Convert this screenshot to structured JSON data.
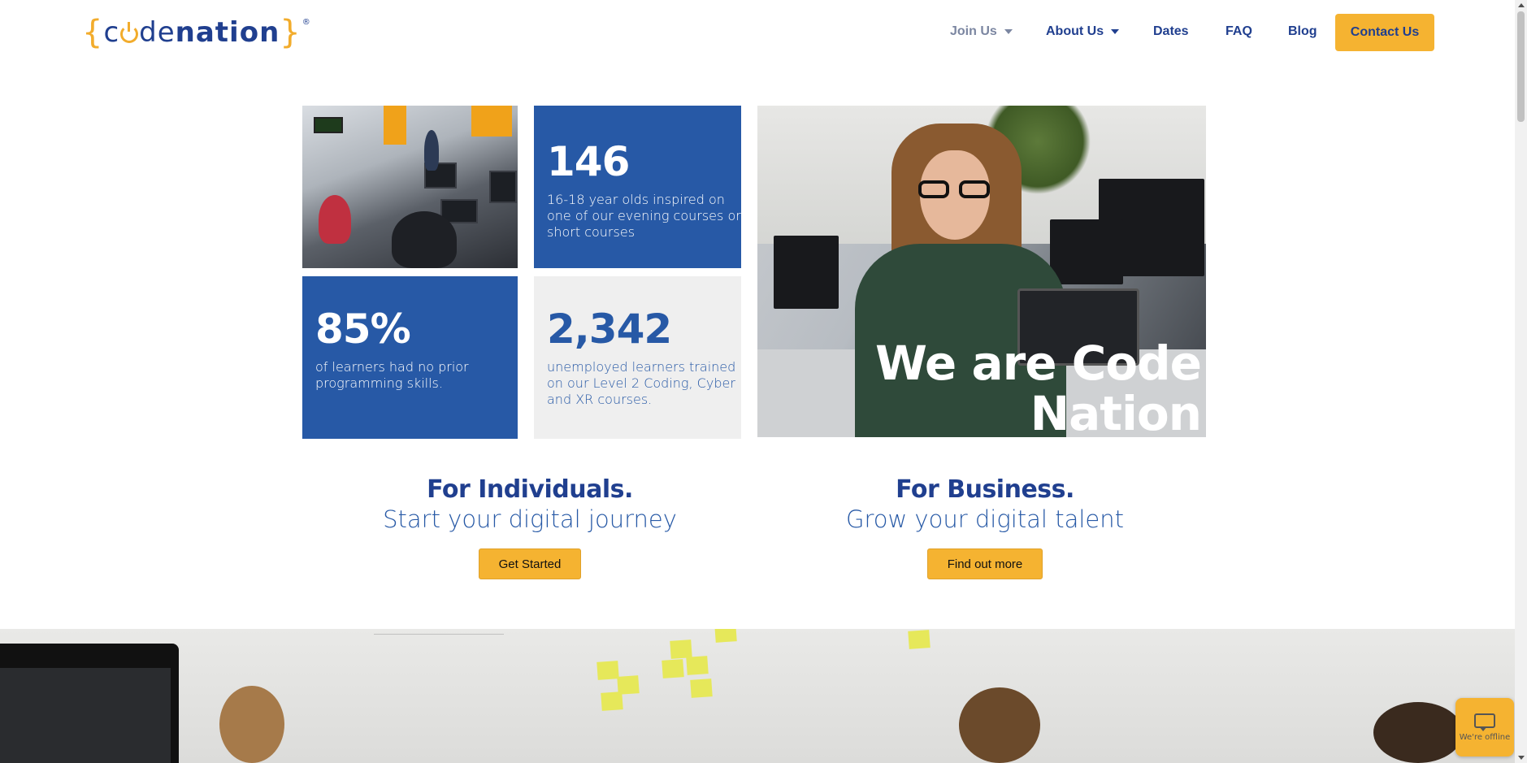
{
  "brand": {
    "logo_open": "{",
    "logo_code_c": "c",
    "logo_code_rest": "de",
    "logo_nation": "nation",
    "logo_close": "}",
    "logo_reg": "®",
    "accent_color": "#f5b331",
    "primary_color": "#203f8f",
    "stat_blue": "#2759a6"
  },
  "nav": {
    "items": [
      {
        "label": "Join Us",
        "dropdown": true,
        "active": true
      },
      {
        "label": "About Us",
        "dropdown": true
      },
      {
        "label": "Dates"
      },
      {
        "label": "FAQ"
      },
      {
        "label": "Blog"
      }
    ],
    "cta": "Contact Us"
  },
  "stats": {
    "s146": {
      "number": "146",
      "text": "16-18 year olds inspired on one of our evening courses or short courses"
    },
    "s85": {
      "number": "85%",
      "text": "of learners had no prior programming skills."
    },
    "s2342": {
      "number": "2,342",
      "text": "unemployed learners trained on our Level 2 Coding, Cyber and XR courses."
    }
  },
  "hero": {
    "overlay_line1": "We are Code",
    "overlay_line2": "Nation"
  },
  "individuals": {
    "heading": "For Individuals.",
    "subheading": "Start your digital journey",
    "button": "Get Started"
  },
  "business": {
    "heading": "For Business.",
    "subheading": "Grow your digital talent",
    "button": "Find out more"
  },
  "chat": {
    "icon": "chat-bubble-icon",
    "status": "We're offline"
  }
}
